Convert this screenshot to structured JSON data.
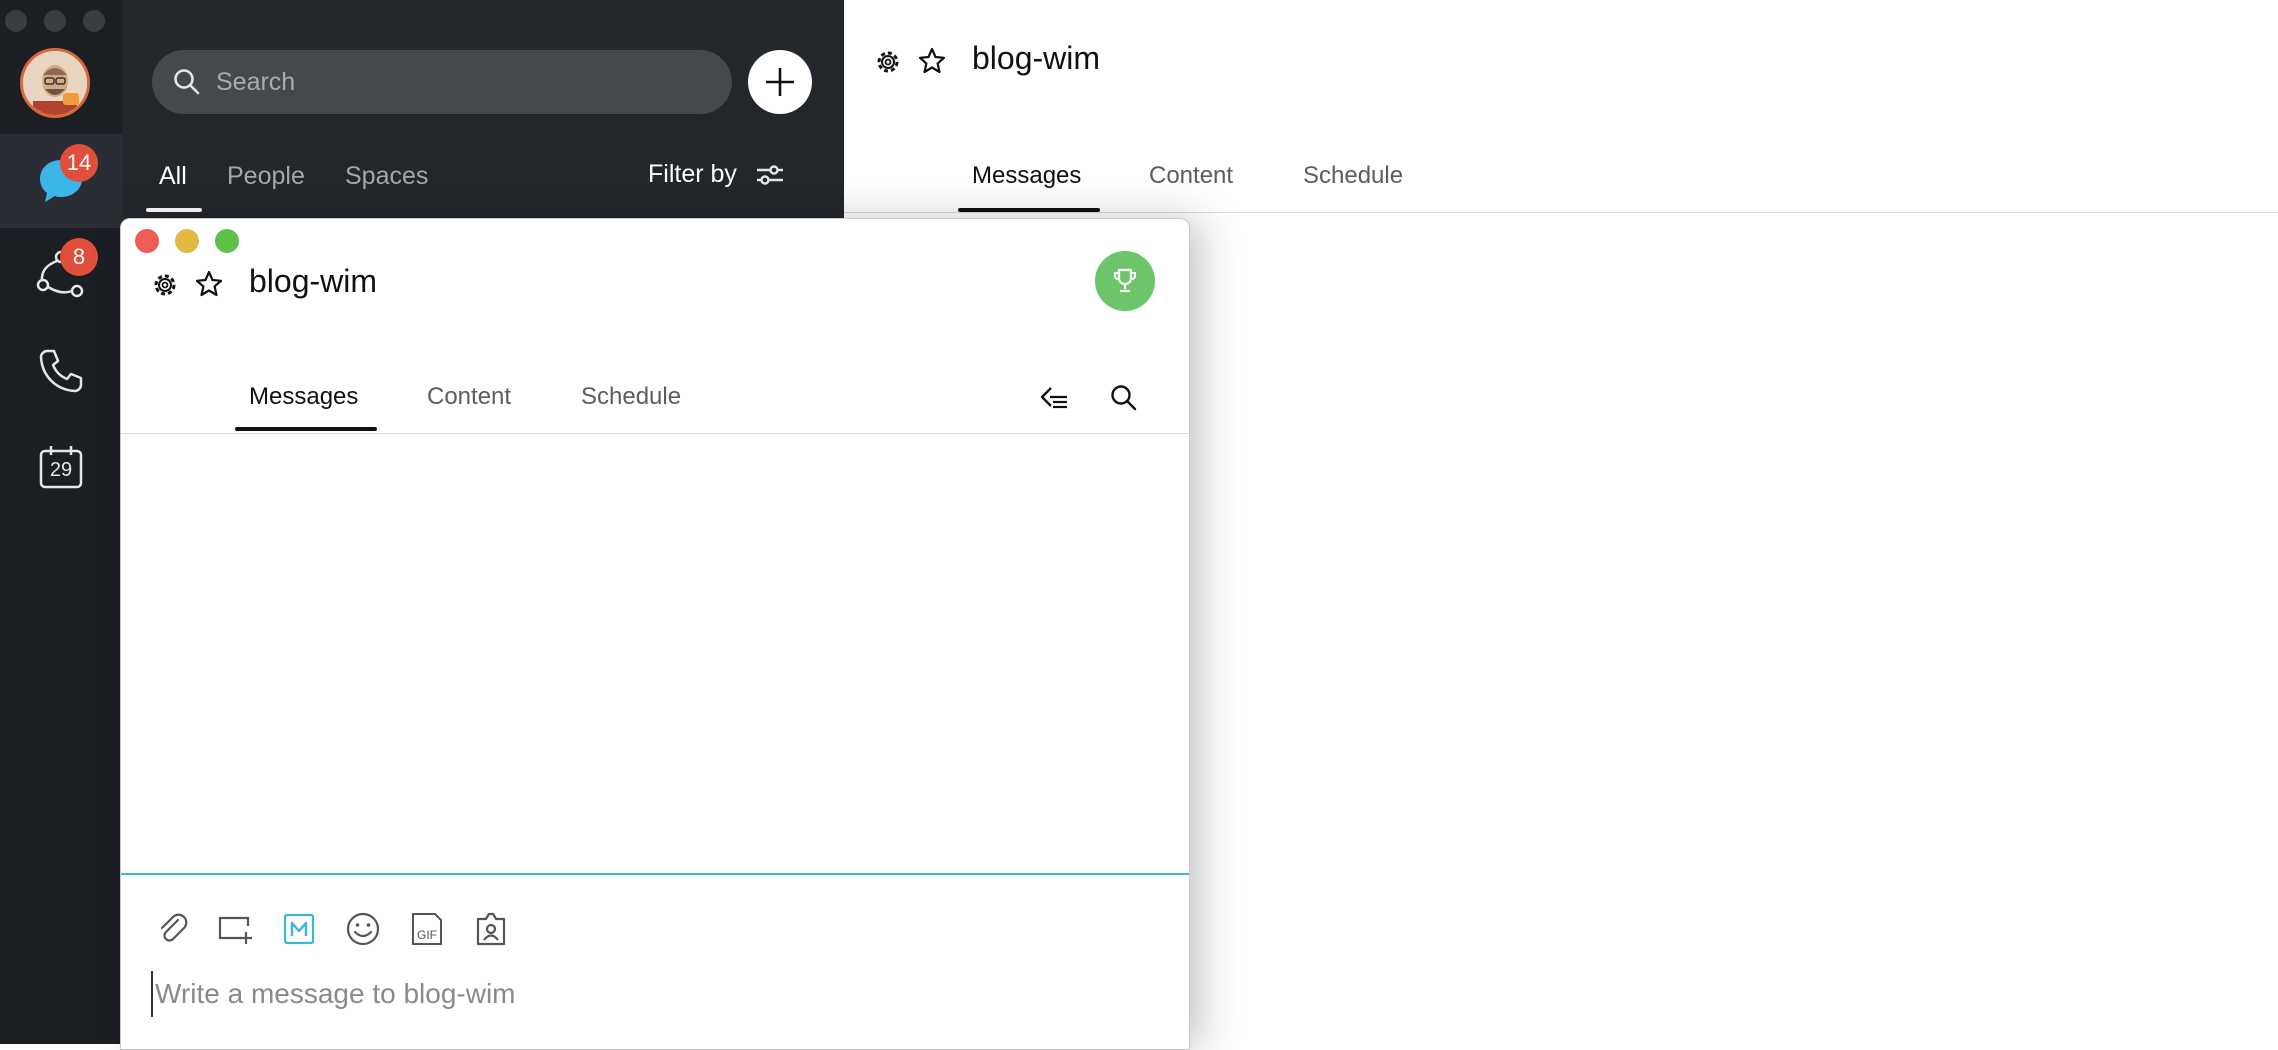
{
  "rail": {
    "chat_badge": "14",
    "teams_badge": "8",
    "calendar_day": "29"
  },
  "list_panel": {
    "search_placeholder": "Search",
    "tabs": [
      {
        "label": "All",
        "active": true
      },
      {
        "label": "People",
        "active": false
      },
      {
        "label": "Spaces",
        "active": false
      }
    ],
    "filter_label": "Filter by"
  },
  "main": {
    "title": "blog-wim",
    "tabs": [
      {
        "label": "Messages",
        "active": true
      },
      {
        "label": "Content",
        "active": false
      },
      {
        "label": "Schedule",
        "active": false
      }
    ]
  },
  "popout": {
    "title": "blog-wim",
    "tabs": [
      {
        "label": "Messages",
        "active": true
      },
      {
        "label": "Content",
        "active": false
      },
      {
        "label": "Schedule",
        "active": false
      }
    ],
    "compose_placeholder": "Write a message to blog-wim",
    "icons": [
      "gear-icon",
      "star-icon",
      "trophy-icon",
      "threads-icon",
      "search-icon",
      "attach-icon",
      "share-screen-icon",
      "markdown-icon",
      "emoji-icon",
      "gif-icon",
      "mention-icon"
    ]
  },
  "colors": {
    "rail_bg": "#1b1e23",
    "list_bg": "#23262b",
    "badge": "#e04f3c",
    "chat_icon": "#3bb6e6",
    "accent_line": "#3bb6d6",
    "trophy_btn": "#6cc56b",
    "close": "#ee5c55",
    "minimize": "#e3b944",
    "maximize": "#5ec14a"
  }
}
